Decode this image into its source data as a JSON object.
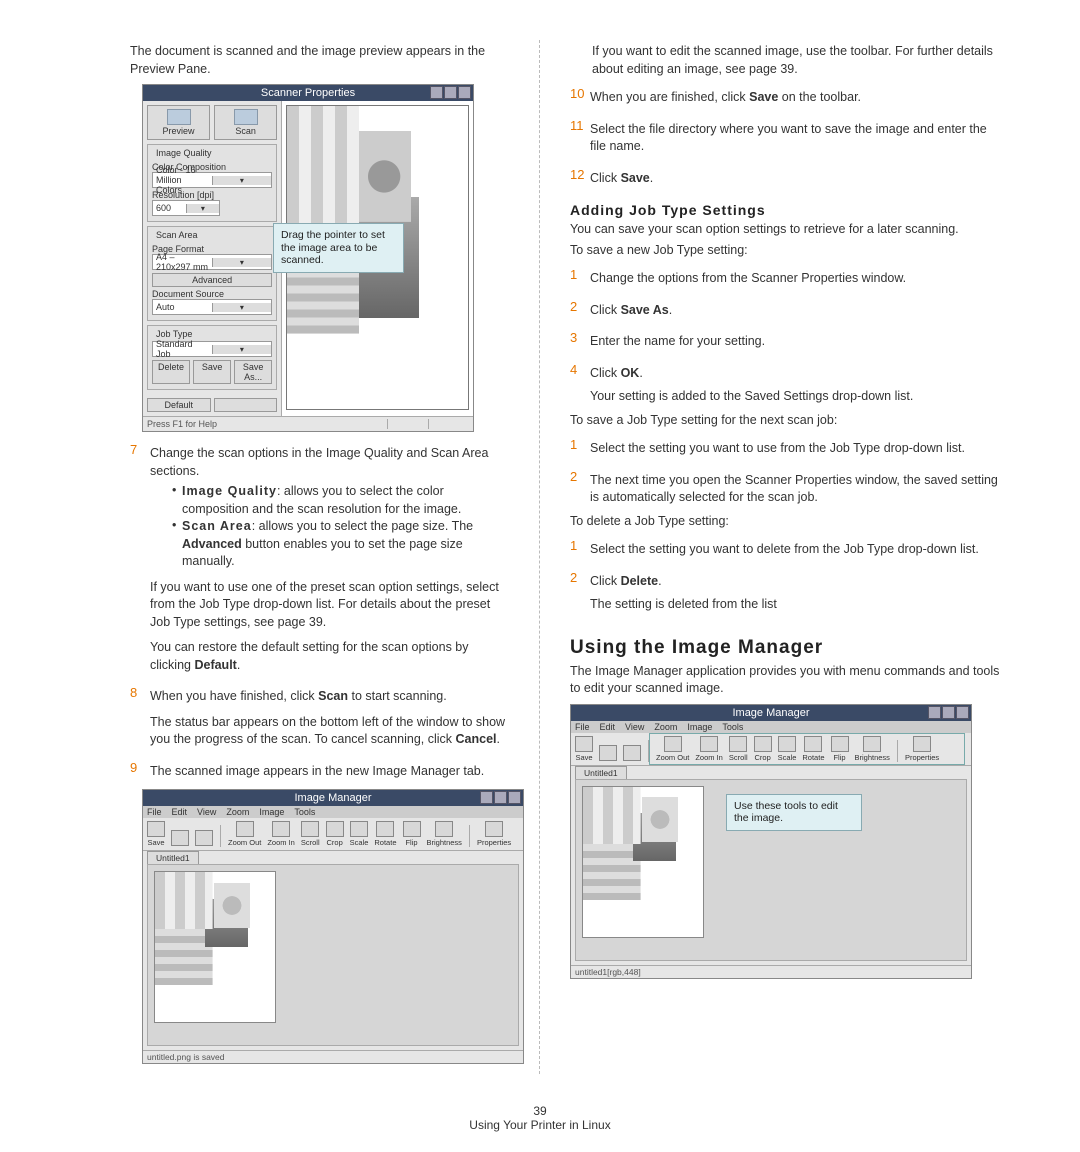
{
  "left": {
    "intro": "The document is scanned and the image preview appears in the Preview Pane.",
    "scanner": {
      "title": "Scanner Properties",
      "preview_btn": "Preview",
      "scan_btn": "Scan",
      "grp_iq": "Image Quality",
      "lbl_comp": "Color Composition",
      "dd_comp": "Color - 16 Million Colors",
      "lbl_res": "Resolution [dpi]",
      "dd_res": "600",
      "grp_sa": "Scan Area",
      "lbl_pf": "Page Format",
      "dd_pf": "A4 – 210x297 mm",
      "btn_adv": "Advanced",
      "lbl_ds": "Document Source",
      "dd_ds": "Auto",
      "grp_jt": "Job Type",
      "dd_jt": "Standard Job",
      "btn_del": "Delete",
      "btn_save": "Save",
      "btn_saveas": "Save As...",
      "btn_def": "Default",
      "status": "Press F1 for Help",
      "callout": "Drag the pointer to set the image area to be scanned."
    },
    "s7": {
      "num": "7",
      "p1": "Change the scan options in the Image Quality and Scan Area sections.",
      "b1a": "Image Quality",
      "b1b": ": allows you to select the color composition and the scan resolution for the image.",
      "b2a": "Scan Area",
      "b2b": ": allows you to select the page size. The ",
      "b2c": "Advanced",
      "b2d": " button enables you to set the page size manually.",
      "p2a": "If you want to use one of the preset scan option settings, select from the Job Type drop-down list. For details about the preset Job Type settings, see page 39.",
      "p3a": "You can restore the default setting for the scan options by clicking ",
      "p3b": "Default",
      "p3c": "."
    },
    "s8": {
      "num": "8",
      "p1a": "When you have finished, click ",
      "p1b": "Scan",
      "p1c": " to start scanning.",
      "p2a": "The status bar appears on the bottom left of the window to show you the progress of the scan. To cancel scanning, click ",
      "p2b": "Cancel",
      "p2c": "."
    },
    "s9": {
      "num": "9",
      "p1": "The scanned image appears in the new Image Manager tab."
    },
    "immgr": {
      "title": "Image Manager",
      "menu": [
        "File",
        "Edit",
        "View",
        "Zoom",
        "Image",
        "Tools"
      ],
      "tools": [
        "Save",
        "",
        "",
        "Zoom Out",
        "Zoom In",
        "Scroll",
        "Crop",
        "Scale",
        "Rotate",
        "Flip",
        "Brightness",
        "Properties"
      ],
      "tab": "Untitled1",
      "status": "untitled.png is saved"
    }
  },
  "right": {
    "p_top": "If you want to edit the scanned image, use the toolbar. For further details about editing an image, see page 39.",
    "s10": {
      "num": "10",
      "p1a": "When you are finished, click ",
      "p1b": "Save",
      "p1c": " on the toolbar."
    },
    "s11": {
      "num": "11",
      "p1": "Select the file directory where you want to save the image and enter the file name."
    },
    "s12": {
      "num": "12",
      "p1a": "Click ",
      "p1b": "Save",
      "p1c": "."
    },
    "add_head": "Adding Job Type Settings",
    "add_p1": "You can save your scan option settings to retrieve for a later scanning.",
    "add_p2": "To save a new Job Type setting:",
    "a1": {
      "num": "1",
      "t": "Change the options from the Scanner Properties window."
    },
    "a2": {
      "num": "2",
      "t1": "Click ",
      "t2": "Save As",
      "t3": "."
    },
    "a3": {
      "num": "3",
      "t": "Enter the name for your setting."
    },
    "a4": {
      "num": "4",
      "t1": "Click ",
      "t2": "OK",
      "t3": ".",
      "t4": "Your setting is added to the Saved Settings drop-down list."
    },
    "add_p3": "To save a Job Type setting for the next scan job:",
    "b1": {
      "num": "1",
      "t": "Select the setting you want to use from the Job Type drop-down list."
    },
    "b2": {
      "num": "2",
      "t": "The next time you open the Scanner Properties window, the saved setting is automatically selected for the scan job."
    },
    "add_p4": "To delete a Job Type setting:",
    "c1": {
      "num": "1",
      "t": "Select the setting you want to delete from the Job Type drop-down list."
    },
    "c2": {
      "num": "2",
      "t1": "Click ",
      "t2": "Delete",
      "t3": ".",
      "t4": "The setting is deleted from the list"
    },
    "h2": "Using the Image Manager",
    "h2_p": "The Image Manager application provides you with menu commands and tools to edit your scanned image.",
    "callout2": "Use these tools to edit the image.",
    "im_status": "untitled1[rgb,448]"
  },
  "footer": {
    "page": "39",
    "section": "Using Your Printer in Linux"
  }
}
